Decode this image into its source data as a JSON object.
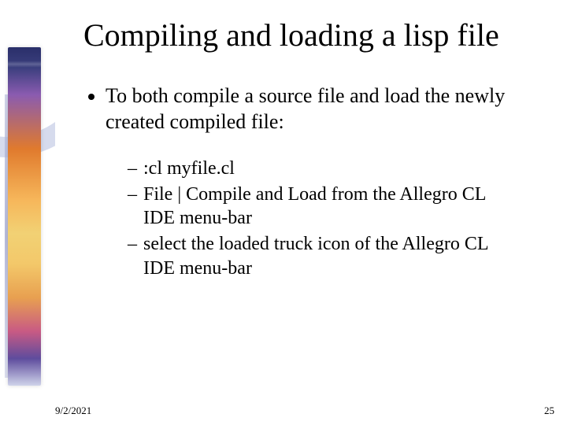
{
  "slide": {
    "title": "Compiling and loading a lisp file",
    "bullets": [
      {
        "text": "To both compile a source file and load the newly created compiled file:",
        "sub": [
          ":cl myfile.cl",
          " File | Compile and Load  from the Allegro CL IDE menu-bar",
          "select the loaded truck icon of the Allegro CL IDE menu-bar"
        ]
      }
    ]
  },
  "footer": {
    "date": "9/2/2021",
    "page": "25"
  }
}
